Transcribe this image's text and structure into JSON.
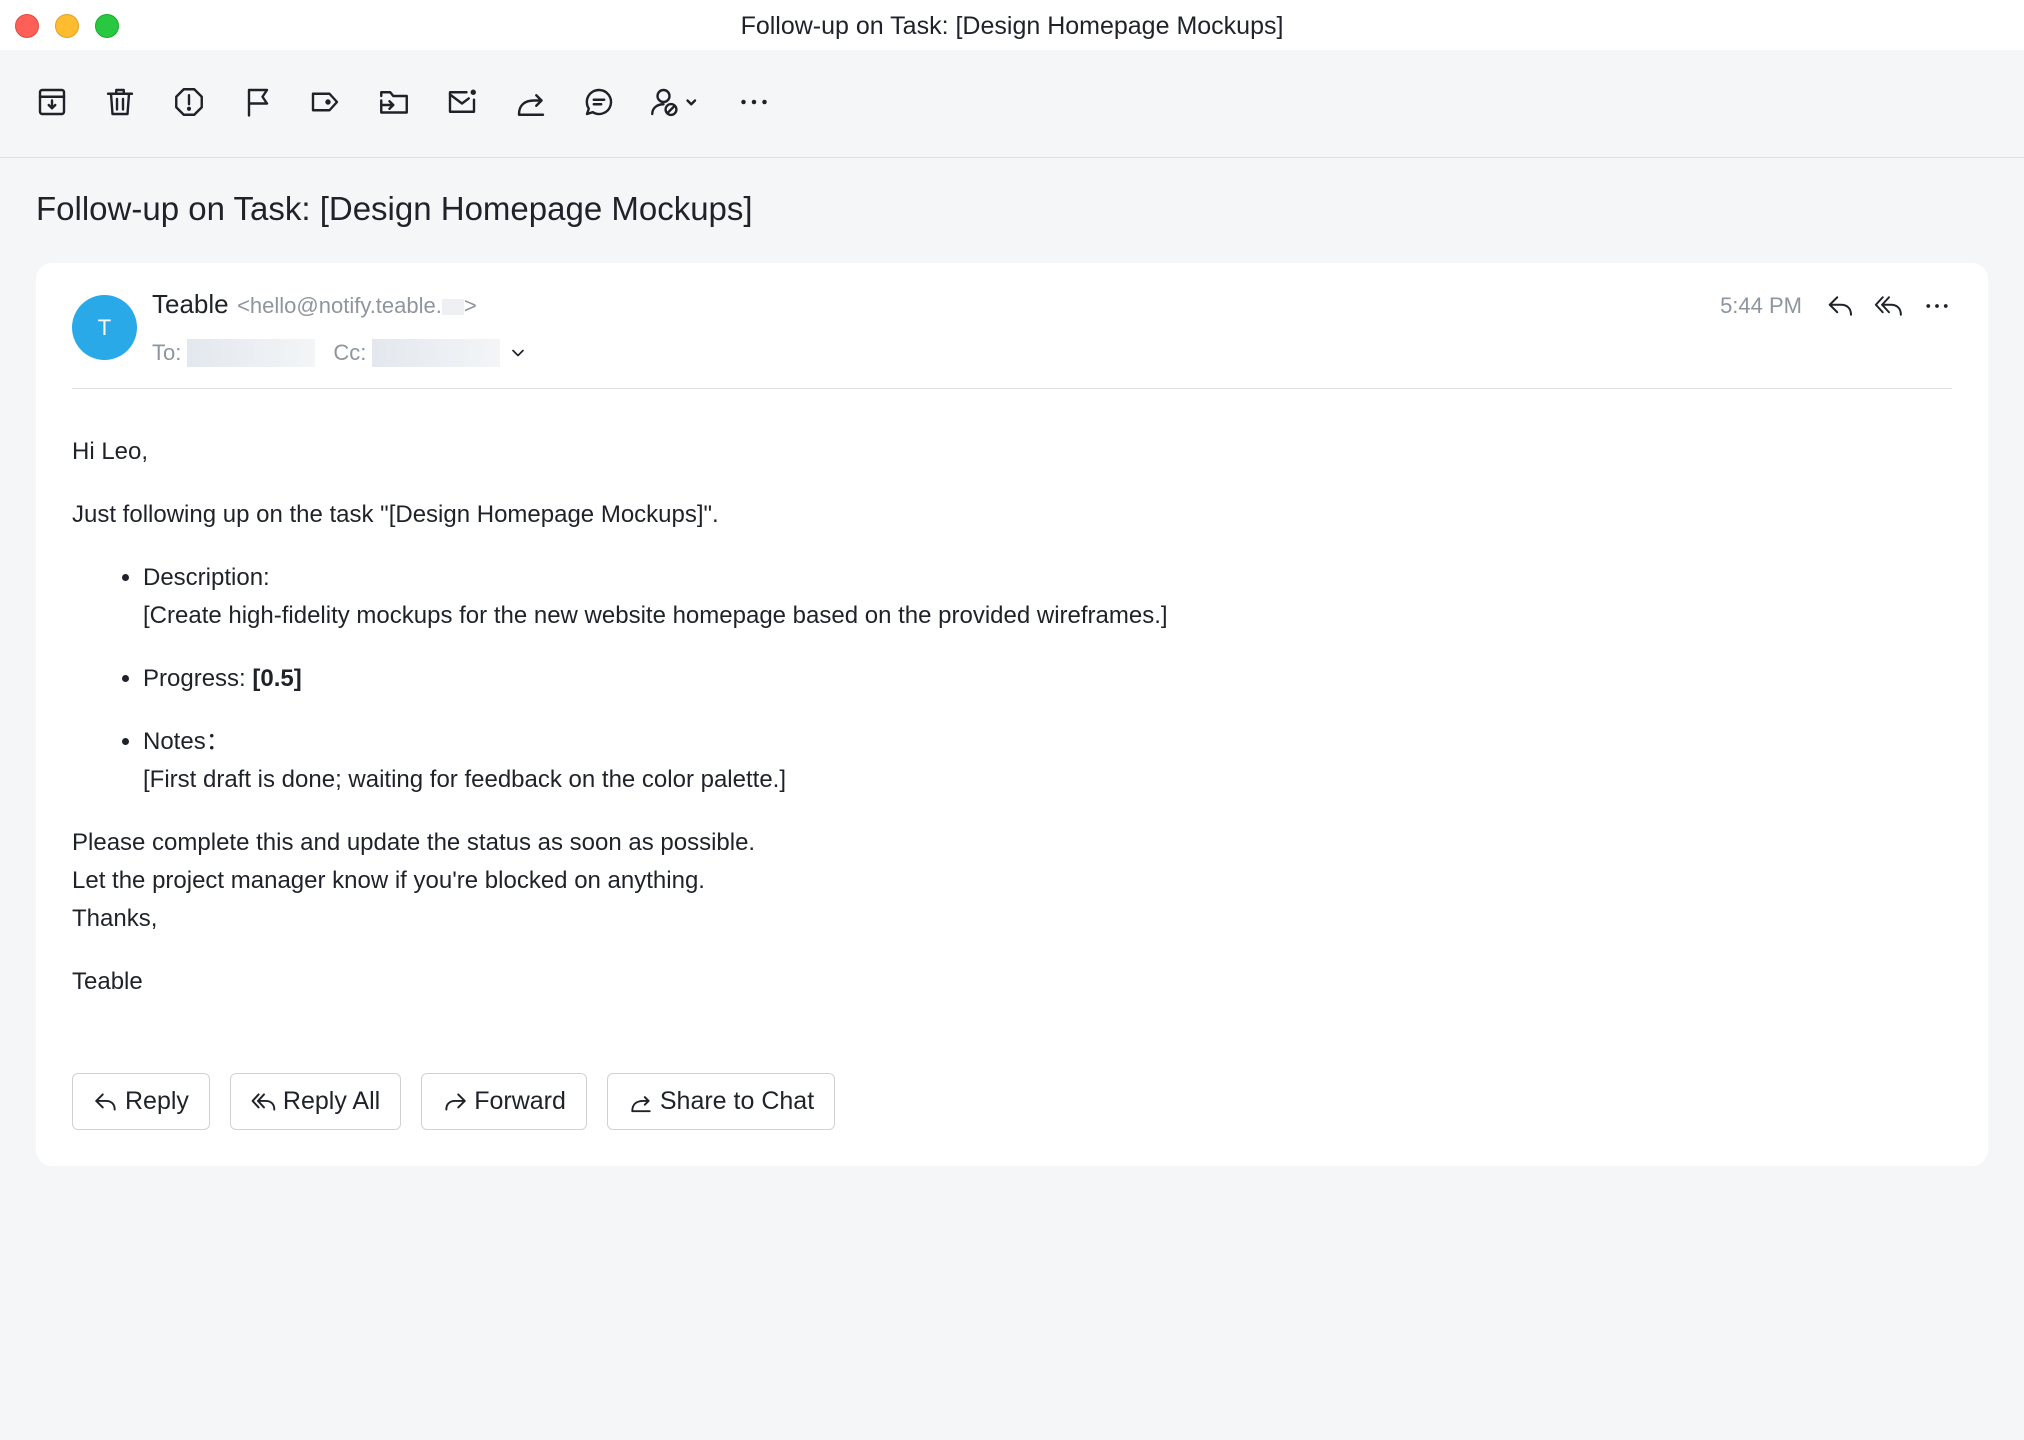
{
  "window": {
    "title": "Follow-up on Task: [Design Homepage Mockups]"
  },
  "toolbar": {
    "icons": [
      "archive-icon",
      "trash-icon",
      "spam-icon",
      "flag-icon",
      "label-icon",
      "move-to-folder-icon",
      "mark-unread-icon",
      "forward-icon",
      "comment-icon",
      "block-sender-icon",
      "more-icon"
    ]
  },
  "email": {
    "subject": "Follow-up on Task: [Design Homepage Mockups]",
    "avatar_initial": "T",
    "sender_name": "Teable",
    "sender_email_prefix": "<hello@notify.teable.",
    "sender_email_suffix": ">",
    "to_label": "To:",
    "cc_label": "Cc:",
    "time": "5:44 PM",
    "body": {
      "greeting": "Hi Leo,",
      "intro": "Just following up on the task \"[Design Homepage Mockups]\".",
      "items": {
        "description_label": "Description:",
        "description_value": "[Create high-fidelity mockups for the new website homepage based on the provided wireframes.]",
        "progress_label": "Progress: ",
        "progress_value": "[0.5]",
        "notes_label": "Notes：",
        "notes_value": "[First draft is done; waiting for feedback on the color palette.]"
      },
      "line1": "Please complete this and update the status as soon as possible.",
      "line2": "Let the project manager know if you're blocked on anything.",
      "line3": "Thanks,",
      "signature": "Teable"
    }
  },
  "actions": {
    "reply": "Reply",
    "reply_all": "Reply All",
    "forward": "Forward",
    "share": "Share to Chat"
  },
  "colors": {
    "avatar": "#29a9e8",
    "close": "#fe5f57",
    "minimize": "#febc2e",
    "maximize": "#28c840"
  }
}
